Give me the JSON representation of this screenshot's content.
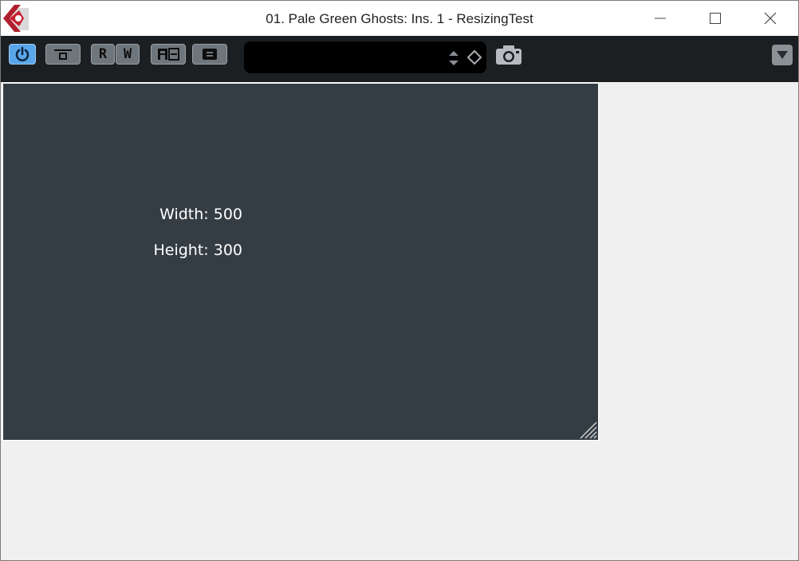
{
  "window": {
    "title": "01. Pale Green Ghosts: Ins. 1 - ResizingTest",
    "controls": [
      "minimize-icon",
      "maximize-icon",
      "close-icon"
    ]
  },
  "toolbar": {
    "buttons": [
      {
        "name": "power-button",
        "icon": "power-icon",
        "active": true,
        "accent": "#5aa6ea"
      },
      {
        "name": "bypass-button",
        "icon": "bypass-icon"
      },
      {
        "name": "read-automation-button",
        "label": "R"
      },
      {
        "name": "write-automation-button",
        "label": "W"
      },
      {
        "name": "ab-compare-button",
        "icon": "ab-icon"
      },
      {
        "name": "preset-menu-button",
        "icon": "menu-icon"
      }
    ],
    "preset": {
      "value": "",
      "icons": [
        "up-down-arrows-icon",
        "diamond-icon"
      ]
    },
    "snapshot_icon": "camera-icon",
    "dropdown_icon": "triangle-down-icon"
  },
  "plugin": {
    "width_text": "Width: 500",
    "height_text": "Height: 300",
    "background": "#343d44"
  }
}
